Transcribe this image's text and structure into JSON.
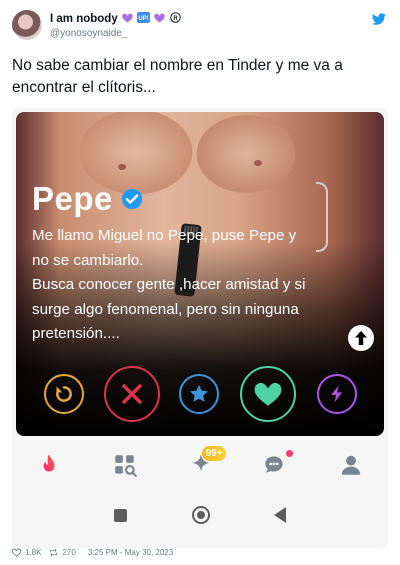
{
  "tweet": {
    "display_name": "I am nobody",
    "handle": "@yonosoynaide_",
    "text": "No sabe cambiar el nombre en Tinder y me va a encontrar el clítoris...",
    "likes": "1.8K",
    "retweets": "270",
    "timestamp": "3:25 PM - May 30, 2023",
    "brand_color": "#1d9bf0"
  },
  "name_emojis": [
    "purple-heart",
    "up-button-emoji",
    "purple-heart",
    "registered-sign"
  ],
  "profile": {
    "name": "Pepe",
    "verified_icon": "verified-badge",
    "bio_lines": [
      "Me llamo Miguel no Pepe, puse Pepe y",
      "no se cambiarlo.",
      "Busca conocer gente ,hacer amistad y si",
      "surge algo fenomenal, pero sin ninguna",
      "pretensión...."
    ]
  },
  "actions": [
    "rewind",
    "nope",
    "super-like",
    "like",
    "boost"
  ],
  "tinder_nav": {
    "items": [
      "flame",
      "explore",
      "sparks",
      "chat",
      "profile"
    ],
    "badge": "99+"
  },
  "android_nav": [
    "recents",
    "home",
    "back"
  ],
  "colors": {
    "rewind": "#e7a93d",
    "nope": "#d8344a",
    "super_like": "#3b94d8",
    "like": "#4fd2a5",
    "boost": "#a559e8",
    "verified": "#1d9bf0",
    "tinder": "#fd4f62"
  }
}
